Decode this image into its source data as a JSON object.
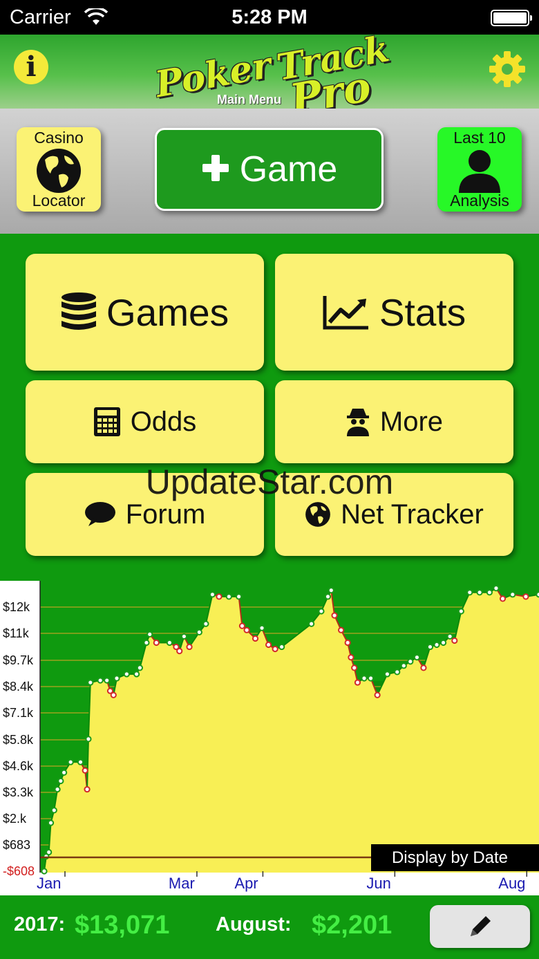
{
  "status": {
    "carrier": "Carrier",
    "time": "5:28 PM"
  },
  "header": {
    "logo_line1": "Poker Track",
    "logo_poker": "Poker",
    "logo_track": "Track",
    "logo_pro": "Pro",
    "subtitle": "Main Menu"
  },
  "toolbar": {
    "casino_top": "Casino",
    "casino_bottom": "Locator",
    "game_label": "Game",
    "last10_top": "Last 10",
    "last10_bottom": "Analysis"
  },
  "menu": {
    "games": "Games",
    "stats": "Stats",
    "odds": "Odds",
    "more": "More",
    "forum": "Forum",
    "net_tracker": "Net Tracker"
  },
  "watermark": "UpdateStar.com",
  "colors": {
    "accent": "#0f9a0f",
    "tile": "#fbf274",
    "last10": "#27f827",
    "chart_fill": "#f8ef55"
  },
  "chart_data": {
    "type": "area",
    "year_label": "2017",
    "display_mode": "Display by Date",
    "y_ticks": [
      "$12k",
      "$11k",
      "$9.7k",
      "$8.4k",
      "$7.1k",
      "$5.8k",
      "$4.6k",
      "$3.3k",
      "$2.k",
      "$683",
      "-$608"
    ],
    "y_values": [
      12000,
      10700,
      9700,
      8400,
      7100,
      5800,
      4600,
      3300,
      2000,
      683,
      -608
    ],
    "x_ticks": [
      "Jan",
      "Mar",
      "Apr",
      "Jun",
      "Aug"
    ],
    "x_tick_months": [
      1,
      3,
      4,
      6,
      8
    ],
    "ylim": [
      -608,
      13000
    ],
    "xlim": [
      1,
      8.5
    ],
    "points": [
      [
        1.0,
        -608
      ],
      [
        1.03,
        100
      ],
      [
        1.07,
        300
      ],
      [
        1.1,
        1700
      ],
      [
        1.15,
        2300
      ],
      [
        1.2,
        3300
      ],
      [
        1.25,
        3700
      ],
      [
        1.3,
        4100
      ],
      [
        1.4,
        4600
      ],
      [
        1.55,
        4600
      ],
      [
        1.62,
        4200
      ],
      [
        1.65,
        3300
      ],
      [
        1.67,
        5700
      ],
      [
        1.7,
        8400
      ],
      [
        1.85,
        8500
      ],
      [
        1.95,
        8500
      ],
      [
        2.0,
        8000
      ],
      [
        2.05,
        7800
      ],
      [
        2.1,
        8600
      ],
      [
        2.25,
        8800
      ],
      [
        2.4,
        8800
      ],
      [
        2.45,
        9100
      ],
      [
        2.55,
        10300
      ],
      [
        2.6,
        10700
      ],
      [
        2.7,
        10300
      ],
      [
        2.9,
        10300
      ],
      [
        3.0,
        10100
      ],
      [
        3.05,
        9900
      ],
      [
        3.12,
        10600
      ],
      [
        3.2,
        10100
      ],
      [
        3.35,
        10800
      ],
      [
        3.45,
        11200
      ],
      [
        3.55,
        12600
      ],
      [
        3.65,
        12500
      ],
      [
        3.8,
        12500
      ],
      [
        3.95,
        12500
      ],
      [
        4.0,
        11100
      ],
      [
        4.07,
        10900
      ],
      [
        4.2,
        10500
      ],
      [
        4.3,
        11000
      ],
      [
        4.4,
        10200
      ],
      [
        4.5,
        10000
      ],
      [
        4.6,
        10100
      ],
      [
        5.05,
        11200
      ],
      [
        5.2,
        11800
      ],
      [
        5.3,
        12500
      ],
      [
        5.35,
        12800
      ],
      [
        5.4,
        11600
      ],
      [
        5.5,
        10900
      ],
      [
        5.6,
        10300
      ],
      [
        5.65,
        9600
      ],
      [
        5.7,
        9100
      ],
      [
        5.75,
        8400
      ],
      [
        5.85,
        8600
      ],
      [
        5.95,
        8600
      ],
      [
        6.05,
        7800
      ],
      [
        6.2,
        8800
      ],
      [
        6.35,
        8900
      ],
      [
        6.45,
        9200
      ],
      [
        6.55,
        9400
      ],
      [
        6.65,
        9600
      ],
      [
        6.75,
        9100
      ],
      [
        6.85,
        10100
      ],
      [
        6.95,
        10200
      ],
      [
        7.05,
        10300
      ],
      [
        7.15,
        10600
      ],
      [
        7.22,
        10400
      ],
      [
        7.32,
        11800
      ],
      [
        7.45,
        12700
      ],
      [
        7.6,
        12700
      ],
      [
        7.75,
        12700
      ],
      [
        7.85,
        12900
      ],
      [
        7.95,
        12400
      ],
      [
        8.1,
        12600
      ],
      [
        8.3,
        12500
      ],
      [
        8.5,
        12600
      ]
    ]
  },
  "footer": {
    "year_label": "2017:",
    "year_value": "$13,071",
    "month_label": "August:",
    "month_value": "$2,201"
  }
}
